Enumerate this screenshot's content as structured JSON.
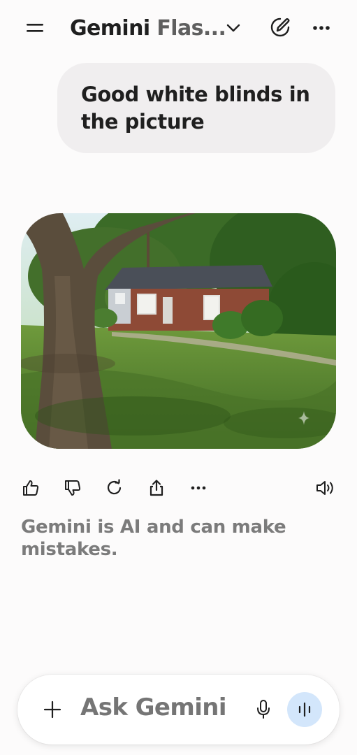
{
  "header": {
    "title_main": "Gemini",
    "title_rest": " Flas...",
    "icons": [
      "menu-icon",
      "chevron-down-icon",
      "edit-icon",
      "more-icon"
    ]
  },
  "chat": {
    "user_message": "Good white blinds in the picture",
    "image": {
      "description_icon": "image"
    }
  },
  "response_actions": {
    "icons": [
      "thumbs-up-icon",
      "thumbs-down-icon",
      "regenerate-icon",
      "share-icon",
      "more-icon",
      "speaker-icon"
    ]
  },
  "disclaimer": "Gemini is AI and can make mistakes.",
  "composer": {
    "placeholder": "Ask Gemini",
    "icons": [
      "plus-icon",
      "mic-icon",
      "live-icon"
    ],
    "accent_color": "#d3e6fb"
  }
}
